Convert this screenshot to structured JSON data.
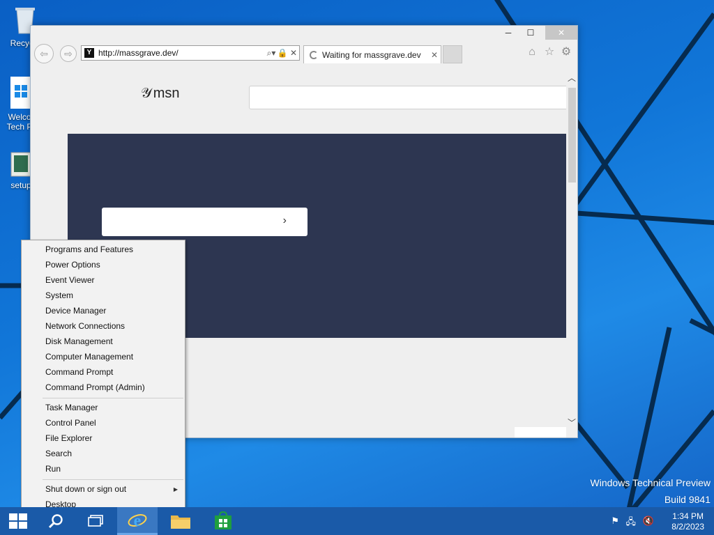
{
  "desktop": {
    "icons": [
      {
        "name": "recycle-bin",
        "label": "Recycle"
      },
      {
        "name": "welcome",
        "label_line1": "Welcor",
        "label_line2": "Tech Pr"
      },
      {
        "name": "setup",
        "label": "setup"
      }
    ],
    "watermark": {
      "line1": "Windows Technical Preview",
      "line2": "Build 9841"
    }
  },
  "browser": {
    "url": "http://massgrave.dev/",
    "favicon_letter": "Y",
    "tab_title": "Waiting for massgrave.dev",
    "page": {
      "logo_text": "msn",
      "hero_color": "#2d3651"
    },
    "window_buttons": {
      "minimize": "─",
      "maximize": "☐",
      "close": "✕"
    }
  },
  "context_menu": {
    "group1": [
      "Programs and Features",
      "Power Options",
      "Event Viewer",
      "System",
      "Device Manager",
      "Network Connections",
      "Disk Management",
      "Computer Management",
      "Command Prompt",
      "Command Prompt (Admin)"
    ],
    "group2": [
      "Task Manager",
      "Control Panel",
      "File Explorer",
      "Search",
      "Run"
    ],
    "group3": [
      "Shut down or sign out",
      "Desktop"
    ]
  },
  "taskbar": {
    "items": [
      "start",
      "search",
      "task-view",
      "internet-explorer",
      "file-explorer",
      "store"
    ],
    "active": "internet-explorer",
    "time": "1:34 PM",
    "date": "8/2/2023"
  },
  "colors": {
    "accent": "#1a5aa8",
    "taskbar_active": "#3a78c2"
  }
}
